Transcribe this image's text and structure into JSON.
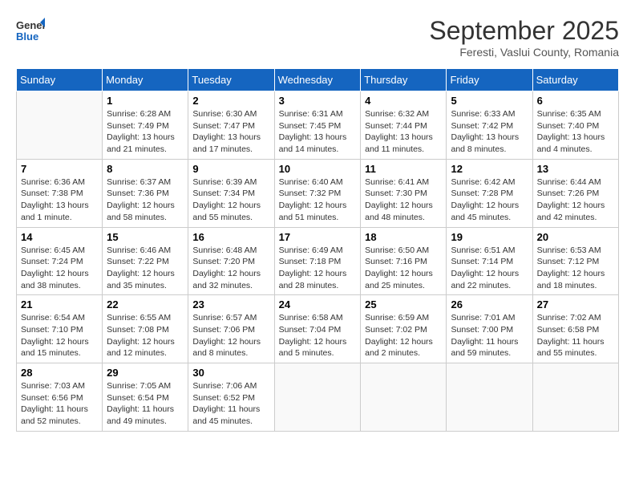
{
  "header": {
    "logo_general": "General",
    "logo_blue": "Blue",
    "month": "September 2025",
    "location": "Feresti, Vaslui County, Romania"
  },
  "weekdays": [
    "Sunday",
    "Monday",
    "Tuesday",
    "Wednesday",
    "Thursday",
    "Friday",
    "Saturday"
  ],
  "weeks": [
    [
      {
        "day": "",
        "info": ""
      },
      {
        "day": "1",
        "info": "Sunrise: 6:28 AM\nSunset: 7:49 PM\nDaylight: 13 hours\nand 21 minutes."
      },
      {
        "day": "2",
        "info": "Sunrise: 6:30 AM\nSunset: 7:47 PM\nDaylight: 13 hours\nand 17 minutes."
      },
      {
        "day": "3",
        "info": "Sunrise: 6:31 AM\nSunset: 7:45 PM\nDaylight: 13 hours\nand 14 minutes."
      },
      {
        "day": "4",
        "info": "Sunrise: 6:32 AM\nSunset: 7:44 PM\nDaylight: 13 hours\nand 11 minutes."
      },
      {
        "day": "5",
        "info": "Sunrise: 6:33 AM\nSunset: 7:42 PM\nDaylight: 13 hours\nand 8 minutes."
      },
      {
        "day": "6",
        "info": "Sunrise: 6:35 AM\nSunset: 7:40 PM\nDaylight: 13 hours\nand 4 minutes."
      }
    ],
    [
      {
        "day": "7",
        "info": "Sunrise: 6:36 AM\nSunset: 7:38 PM\nDaylight: 13 hours\nand 1 minute."
      },
      {
        "day": "8",
        "info": "Sunrise: 6:37 AM\nSunset: 7:36 PM\nDaylight: 12 hours\nand 58 minutes."
      },
      {
        "day": "9",
        "info": "Sunrise: 6:39 AM\nSunset: 7:34 PM\nDaylight: 12 hours\nand 55 minutes."
      },
      {
        "day": "10",
        "info": "Sunrise: 6:40 AM\nSunset: 7:32 PM\nDaylight: 12 hours\nand 51 minutes."
      },
      {
        "day": "11",
        "info": "Sunrise: 6:41 AM\nSunset: 7:30 PM\nDaylight: 12 hours\nand 48 minutes."
      },
      {
        "day": "12",
        "info": "Sunrise: 6:42 AM\nSunset: 7:28 PM\nDaylight: 12 hours\nand 45 minutes."
      },
      {
        "day": "13",
        "info": "Sunrise: 6:44 AM\nSunset: 7:26 PM\nDaylight: 12 hours\nand 42 minutes."
      }
    ],
    [
      {
        "day": "14",
        "info": "Sunrise: 6:45 AM\nSunset: 7:24 PM\nDaylight: 12 hours\nand 38 minutes."
      },
      {
        "day": "15",
        "info": "Sunrise: 6:46 AM\nSunset: 7:22 PM\nDaylight: 12 hours\nand 35 minutes."
      },
      {
        "day": "16",
        "info": "Sunrise: 6:48 AM\nSunset: 7:20 PM\nDaylight: 12 hours\nand 32 minutes."
      },
      {
        "day": "17",
        "info": "Sunrise: 6:49 AM\nSunset: 7:18 PM\nDaylight: 12 hours\nand 28 minutes."
      },
      {
        "day": "18",
        "info": "Sunrise: 6:50 AM\nSunset: 7:16 PM\nDaylight: 12 hours\nand 25 minutes."
      },
      {
        "day": "19",
        "info": "Sunrise: 6:51 AM\nSunset: 7:14 PM\nDaylight: 12 hours\nand 22 minutes."
      },
      {
        "day": "20",
        "info": "Sunrise: 6:53 AM\nSunset: 7:12 PM\nDaylight: 12 hours\nand 18 minutes."
      }
    ],
    [
      {
        "day": "21",
        "info": "Sunrise: 6:54 AM\nSunset: 7:10 PM\nDaylight: 12 hours\nand 15 minutes."
      },
      {
        "day": "22",
        "info": "Sunrise: 6:55 AM\nSunset: 7:08 PM\nDaylight: 12 hours\nand 12 minutes."
      },
      {
        "day": "23",
        "info": "Sunrise: 6:57 AM\nSunset: 7:06 PM\nDaylight: 12 hours\nand 8 minutes."
      },
      {
        "day": "24",
        "info": "Sunrise: 6:58 AM\nSunset: 7:04 PM\nDaylight: 12 hours\nand 5 minutes."
      },
      {
        "day": "25",
        "info": "Sunrise: 6:59 AM\nSunset: 7:02 PM\nDaylight: 12 hours\nand 2 minutes."
      },
      {
        "day": "26",
        "info": "Sunrise: 7:01 AM\nSunset: 7:00 PM\nDaylight: 11 hours\nand 59 minutes."
      },
      {
        "day": "27",
        "info": "Sunrise: 7:02 AM\nSunset: 6:58 PM\nDaylight: 11 hours\nand 55 minutes."
      }
    ],
    [
      {
        "day": "28",
        "info": "Sunrise: 7:03 AM\nSunset: 6:56 PM\nDaylight: 11 hours\nand 52 minutes."
      },
      {
        "day": "29",
        "info": "Sunrise: 7:05 AM\nSunset: 6:54 PM\nDaylight: 11 hours\nand 49 minutes."
      },
      {
        "day": "30",
        "info": "Sunrise: 7:06 AM\nSunset: 6:52 PM\nDaylight: 11 hours\nand 45 minutes."
      },
      {
        "day": "",
        "info": ""
      },
      {
        "day": "",
        "info": ""
      },
      {
        "day": "",
        "info": ""
      },
      {
        "day": "",
        "info": ""
      }
    ]
  ]
}
